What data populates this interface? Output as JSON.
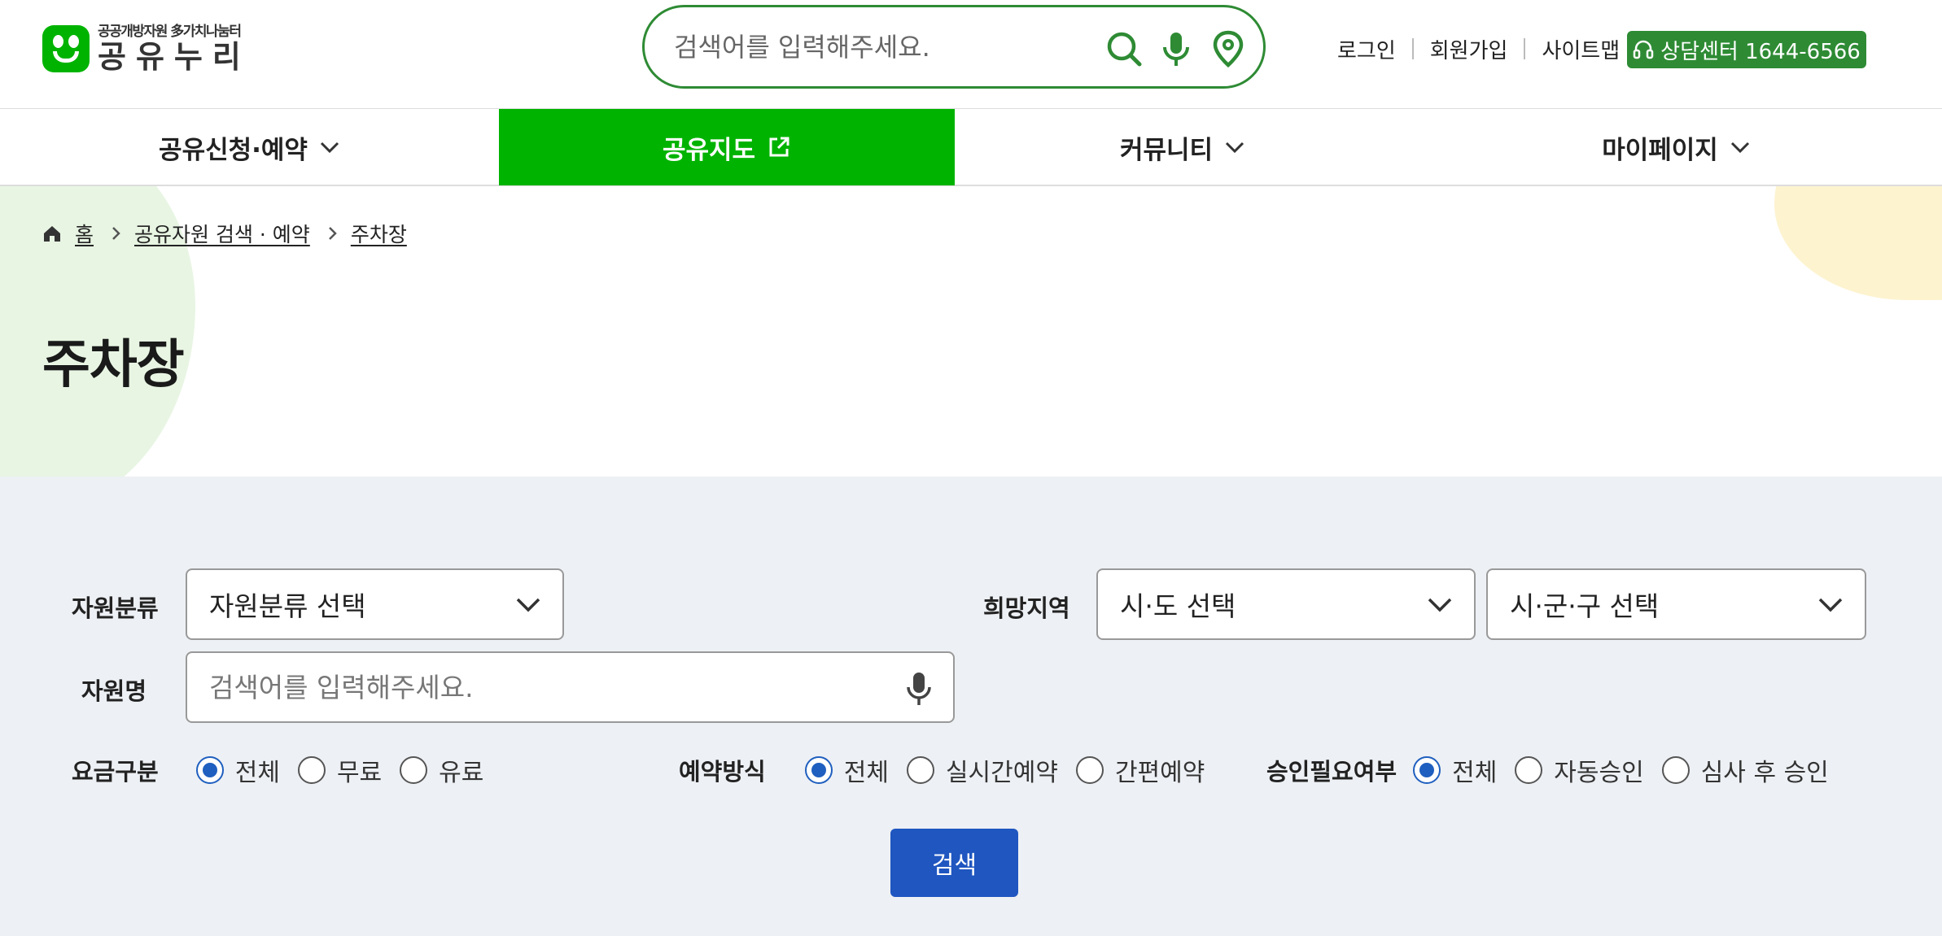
{
  "header": {
    "logo_sub": "공공개방자원 多가치나눔터",
    "logo_main": "공유누리",
    "search_placeholder": "검색어를 입력해주세요.",
    "util_links": [
      "로그인",
      "회원가입",
      "사이트맵"
    ],
    "consult_label": "상담센터 1644-6566"
  },
  "nav": {
    "items": [
      {
        "label": "공유신청·예약",
        "icon": "chevron-down-icon"
      },
      {
        "label": "공유지도",
        "icon": "external-link-icon"
      },
      {
        "label": "커뮤니티",
        "icon": "chevron-down-icon"
      },
      {
        "label": "마이페이지",
        "icon": "chevron-down-icon"
      }
    ]
  },
  "breadcrumb": [
    "홈",
    "공유자원 검색 · 예약",
    "주차장"
  ],
  "page_title": "주차장",
  "filter": {
    "category_label": "자원분류",
    "category_value": "자원분류 선택",
    "region_label": "희망지역",
    "sido_value": "시·도 선택",
    "sigungu_value": "시·군·구 선택",
    "name_label": "자원명",
    "name_placeholder": "검색어를 입력해주세요.",
    "fee": {
      "label": "요금구분",
      "options": [
        "전체",
        "무료",
        "유료"
      ],
      "selected": 0
    },
    "reserve": {
      "label": "예약방식",
      "options": [
        "전체",
        "실시간예약",
        "간편예약"
      ],
      "selected": 0
    },
    "approval": {
      "label": "승인필요여부",
      "options": [
        "전체",
        "자동승인",
        "심사 후 승인"
      ],
      "selected": 0
    },
    "search_label": "검색"
  },
  "colors": {
    "brand_green": "#00b300",
    "dark_green": "#2e8b34",
    "primary_blue": "#1f56c0"
  }
}
